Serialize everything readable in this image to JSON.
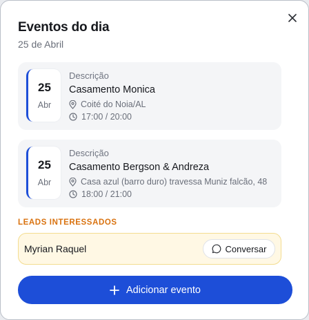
{
  "modal": {
    "title": "Eventos do dia",
    "subtitle": "25 de Abril",
    "close_icon": "close-icon"
  },
  "events": [
    {
      "day": "25",
      "month": "Abr",
      "label": "Descrição",
      "title": "Casamento Monica",
      "location": "Coité do Noia/AL",
      "time": "17:00 / 20:00"
    },
    {
      "day": "25",
      "month": "Abr",
      "label": "Descrição",
      "title": "Casamento Bergson & Andreza",
      "location": "Casa azul (barro duro) travessa Muniz falcão, 48",
      "time": "18:00 / 21:00"
    }
  ],
  "leads": {
    "heading": "LEADS INTERESSADOS",
    "items": [
      {
        "name": "Myrian Raquel",
        "action_label": "Conversar"
      }
    ]
  },
  "footer": {
    "add_label": "Adicionar evento"
  },
  "colors": {
    "accent": "#1d4ed8",
    "leads_heading": "#d9720f",
    "lead_bg": "#fff8e4"
  }
}
